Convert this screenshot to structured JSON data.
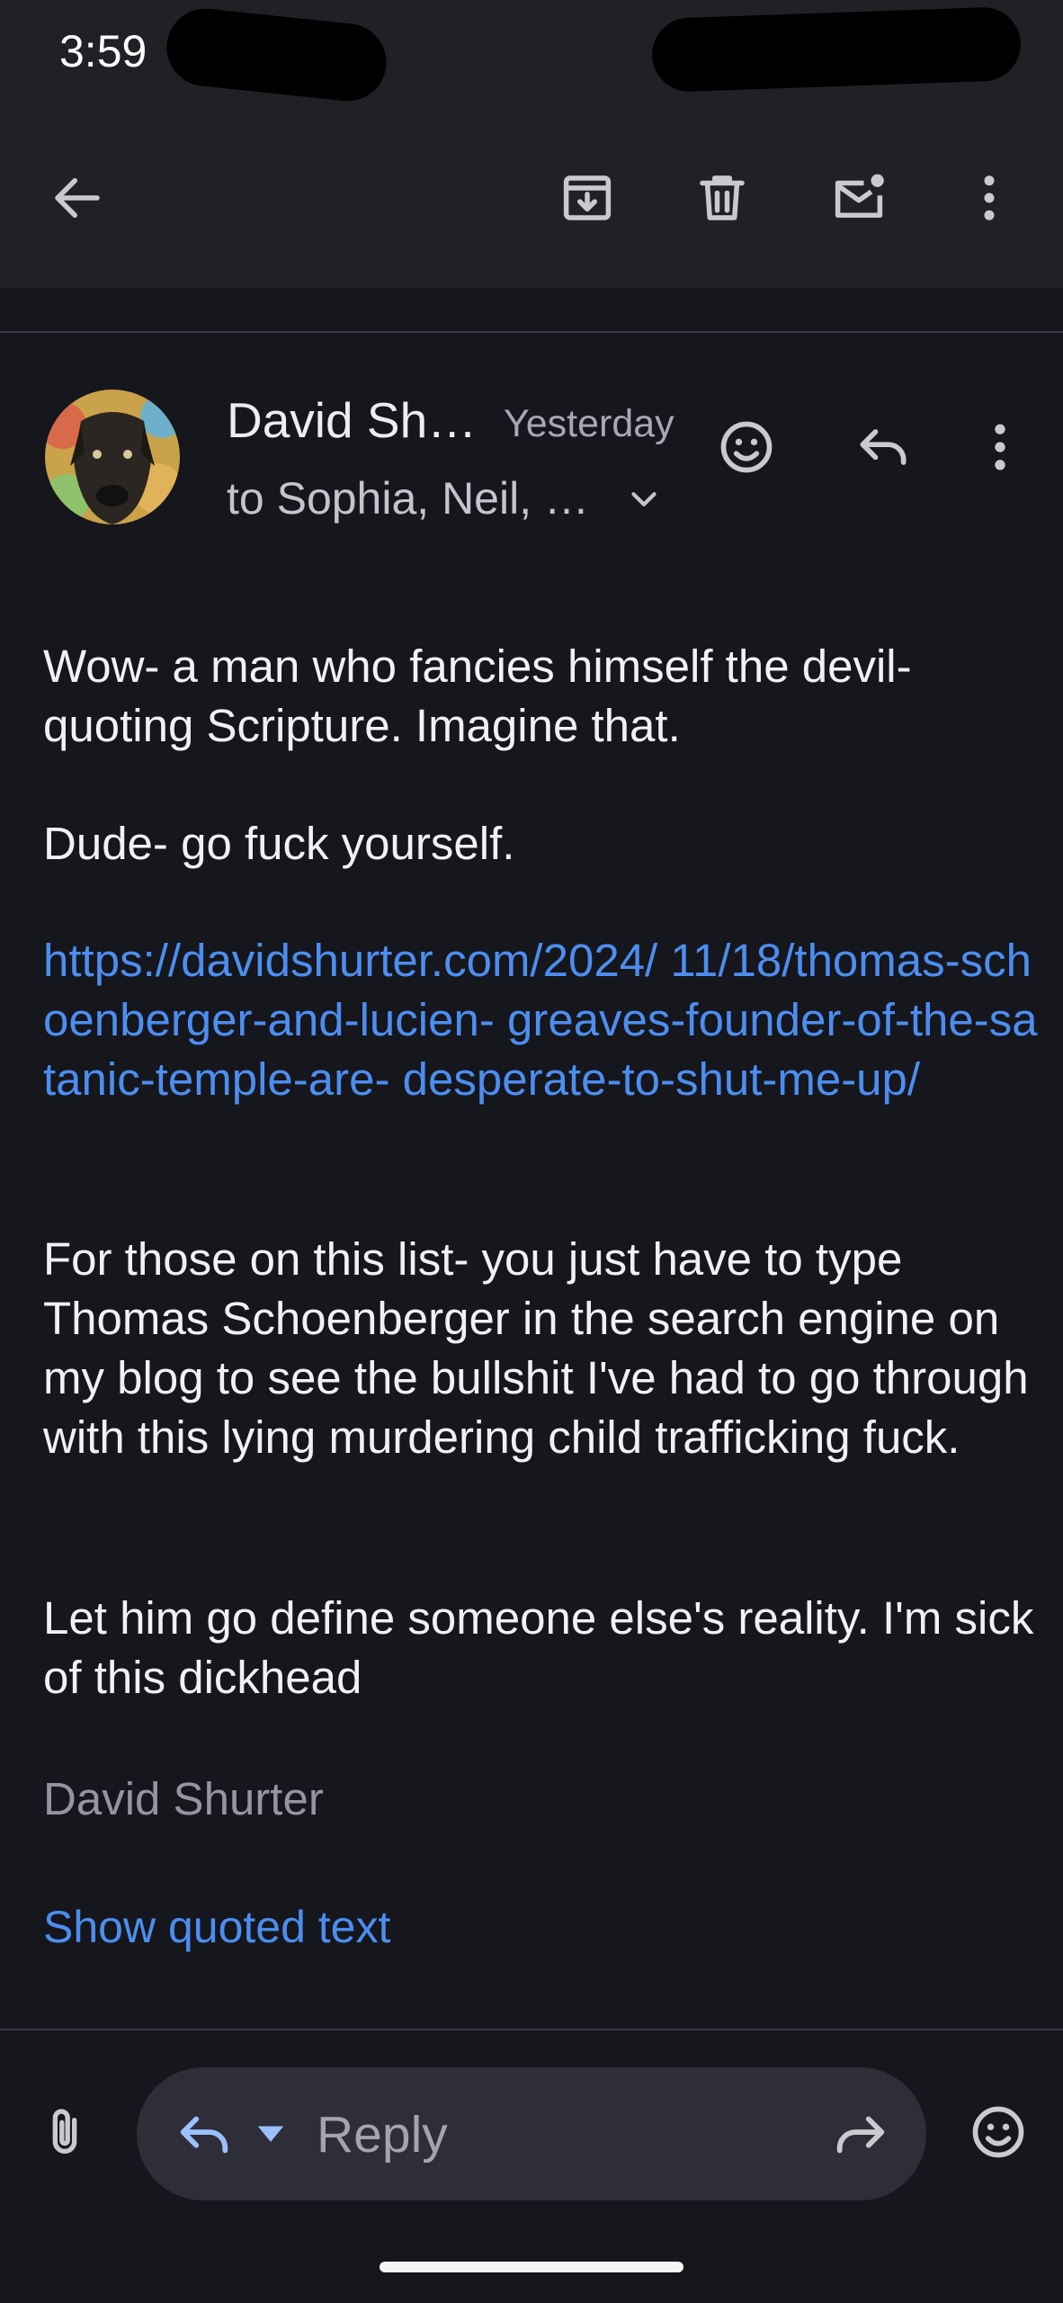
{
  "status_bar": {
    "time": "3:59"
  },
  "email": {
    "sender": "David Sh…",
    "date": "Yesterday",
    "recipients": "to Sophia, Neil, …",
    "body": {
      "p1": "Wow- a man who fancies himself the devil- quoting Scripture. Imagine that.",
      "p2": "Dude- go fuck yourself.",
      "link": "https://davidshurter.com/2024/ 11/18/thomas-schoenberger-and-lucien- greaves-founder-of-the-satanic-temple-are- desperate-to-shut-me-up/",
      "p3": "For those on this list- you just have to type Thomas Schoenberger in the search engine on my blog to see the bullshit I've had to go through with this lying murdering child trafficking fuck.",
      "p4": "Let him go define someone else's reality. I'm sick of this dickhead"
    },
    "signature": "David Shurter",
    "show_quoted": "Show quoted text"
  },
  "reply_bar": {
    "placeholder": "Reply"
  },
  "icons": {
    "toolbar": [
      "back-arrow-icon",
      "archive-icon",
      "delete-icon",
      "mark-unread-icon",
      "more-vert-icon"
    ],
    "header": [
      "add-reaction-icon",
      "reply-icon",
      "more-vert-icon",
      "expand-more-icon"
    ],
    "bottom": [
      "attach-icon",
      "reply-icon",
      "dropdown-caret-icon",
      "forward-icon",
      "emoji-icon"
    ]
  },
  "colors": {
    "background": "#16161d",
    "toolbar": "#202126",
    "link": "#4c8ef0",
    "pill": "#2d2e37"
  }
}
